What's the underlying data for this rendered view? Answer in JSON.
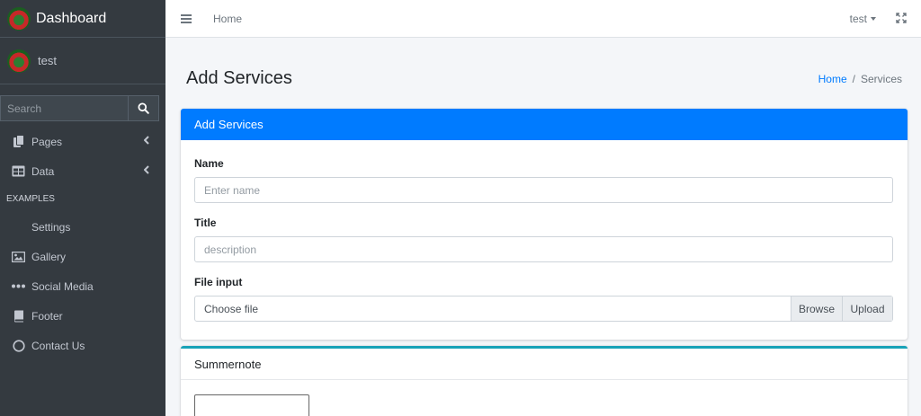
{
  "sidebar": {
    "brand": "Dashboard",
    "user": "test",
    "search_placeholder": "Search",
    "items": [
      {
        "label": "Pages",
        "icon": "copy-icon",
        "has_arrow": true
      },
      {
        "label": "Data",
        "icon": "table-icon",
        "has_arrow": true
      }
    ],
    "header": "EXAMPLES",
    "examples": [
      {
        "label": "Settings",
        "icon": ""
      },
      {
        "label": "Gallery",
        "icon": "image-icon"
      },
      {
        "label": "Social Media",
        "icon": "ellipsis-icon"
      },
      {
        "label": "Footer",
        "icon": "book-icon"
      },
      {
        "label": "Contact Us",
        "icon": "circle-icon"
      }
    ]
  },
  "topbar": {
    "home": "Home",
    "user": "test"
  },
  "page": {
    "title": "Add Services",
    "breadcrumb": {
      "home": "Home",
      "sep": "/",
      "current": "Services"
    }
  },
  "form": {
    "header": "Add Services",
    "name_label": "Name",
    "name_placeholder": "Enter name",
    "title_label": "Title",
    "title_placeholder": "description",
    "file_label": "File input",
    "file_placeholder": "Choose file",
    "browse": "Browse",
    "upload": "Upload"
  },
  "summernote": {
    "header": "Summernote"
  },
  "colors": {
    "primary": "#007bff",
    "sidebar_bg": "#343a40",
    "info_border": "#17a2b8"
  }
}
